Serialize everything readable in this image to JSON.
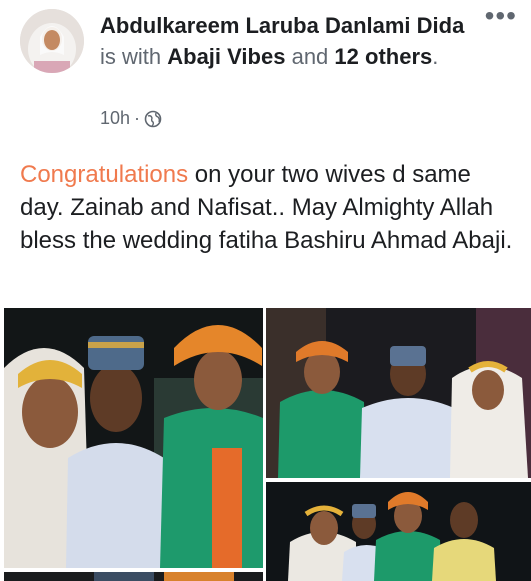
{
  "post": {
    "author": "Abdulkareem Laruba Danlami Dida",
    "with_text": "is with",
    "page": "Abaji Vibes",
    "and_text": "and",
    "others": "12 others",
    "period": ".",
    "time": "10h",
    "separator": "·",
    "privacy_icon": "globe-icon",
    "more_label": "•••",
    "highlight": "Congratulations",
    "body": "on your two wives d same day. Zainab and Nafisat.. May Almighty Allah bless the wedding fatiha Bashiru Ahmad Abaji."
  },
  "colors": {
    "highlight": "#f07a4e",
    "muted": "#606770",
    "text": "#1c1e21"
  },
  "photos": [
    {
      "name": "wedding-photo-1"
    },
    {
      "name": "wedding-photo-2"
    },
    {
      "name": "wedding-photo-3"
    },
    {
      "name": "wedding-photo-4"
    }
  ]
}
